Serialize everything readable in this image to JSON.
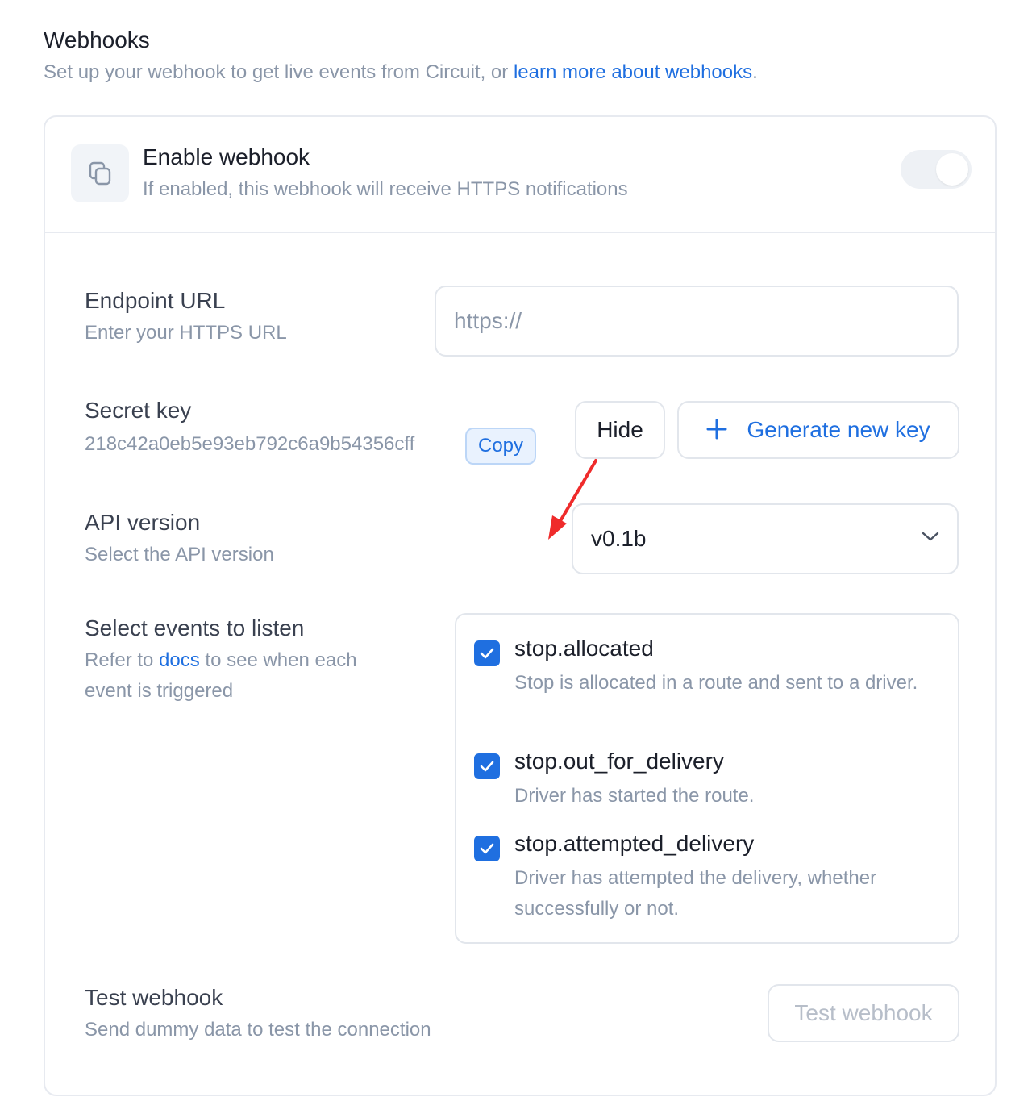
{
  "header": {
    "title": "Webhooks",
    "subtitle_prefix": "Set up your webhook to get live events from Circuit, or ",
    "subtitle_link": "learn more about webhooks",
    "subtitle_suffix": "."
  },
  "enable": {
    "icon": "copy-layers-icon",
    "title": "Enable webhook",
    "description": "If enabled, this webhook will receive HTTPS notifications",
    "toggle_state": "off"
  },
  "endpoint": {
    "label": "Endpoint URL",
    "hint": "Enter your HTTPS URL",
    "value": "",
    "placeholder": "https://"
  },
  "secret": {
    "label": "Secret key",
    "value": "218c42a0eb5e93eb792c6a9b54356cff",
    "copy_label": "Copy",
    "hide_label": "Hide",
    "generate_label": "Generate new key"
  },
  "api_version": {
    "label": "API version",
    "hint": "Select the API version",
    "selected": "v0.1b"
  },
  "events": {
    "label": "Select events to listen",
    "hint_prefix": "Refer to ",
    "hint_link": "docs",
    "hint_suffix": " to see when each event is triggered",
    "items": [
      {
        "name": "stop.allocated",
        "description": "Stop is allocated in a route and sent to a driver.",
        "checked": true
      },
      {
        "name": "stop.out_for_delivery",
        "description": "Driver has started the route.",
        "checked": true
      },
      {
        "name": "stop.attempted_delivery",
        "description": "Driver has attempted the delivery, whether successfully or not.",
        "checked": true
      }
    ]
  },
  "test": {
    "label": "Test webhook",
    "hint": "Send dummy data to test the connection",
    "button_label": "Test webhook"
  },
  "colors": {
    "accent": "#1f6fe0",
    "muted_text": "#8a96a8",
    "border": "#e2e6ec",
    "annotation_arrow": "#ef2b2b"
  }
}
